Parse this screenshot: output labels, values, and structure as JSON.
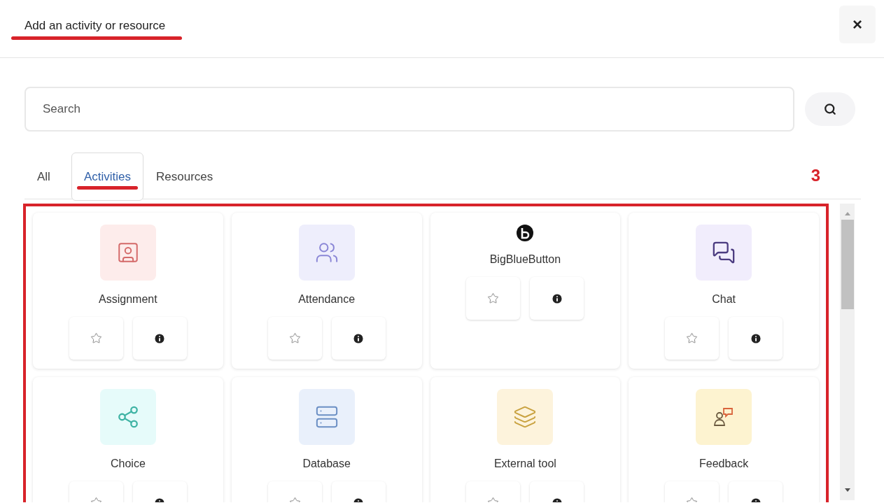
{
  "dialog": {
    "title": "Add an activity or resource",
    "close": "×"
  },
  "search": {
    "placeholder": "Search"
  },
  "tabs": [
    {
      "label": "All",
      "selected": false
    },
    {
      "label": "Activities",
      "selected": true
    },
    {
      "label": "Resources",
      "selected": false
    }
  ],
  "annotation": {
    "label": "3"
  },
  "items": [
    {
      "name": "Assignment",
      "kind": "tile",
      "color": "#fdeceb"
    },
    {
      "name": "Attendance",
      "kind": "tile",
      "color": "#eeeefc"
    },
    {
      "name": "BigBlueButton",
      "kind": "logo"
    },
    {
      "name": "Chat",
      "kind": "tile",
      "color": "#f1edfc"
    },
    {
      "name": "Choice",
      "kind": "tile",
      "color": "#e6fbfa"
    },
    {
      "name": "Database",
      "kind": "tile",
      "color": "#e9f0fb"
    },
    {
      "name": "External tool",
      "kind": "tile",
      "color": "#fdf3dc"
    },
    {
      "name": "Feedback",
      "kind": "tile",
      "color": "#fdf3d0"
    }
  ]
}
